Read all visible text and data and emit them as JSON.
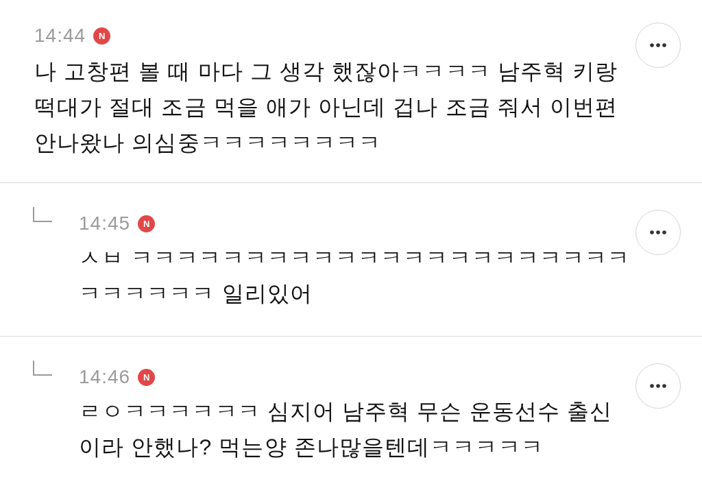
{
  "comments": [
    {
      "kind": "comment",
      "time": "14:44",
      "badge": "N",
      "lines": [
        "나 고창편 볼 때 마다 그 생각 했잖아ㅋㅋㅋㅋ 남주혁 키랑",
        "떡대가 절대 조금 먹을 애가 아닌데 겁나 조금 줘서 이번편",
        "안나왔나 의심중ㅋㅋㅋㅋㅋㅋㅋㅋ"
      ]
    },
    {
      "kind": "reply",
      "time": "14:45",
      "badge": "N",
      "lines": [
        "ㅅㅂ ㅋㅋㅋㅋㅋㅋㅋㅋㅋㅋㅋㅋㅋㅋㅋㅋㅋㅋㅋㅋㅋㅋ",
        "ㅋㅋㅋㅋㅋㅋ 일리있어"
      ]
    },
    {
      "kind": "reply",
      "time": "14:46",
      "badge": "N",
      "lines": [
        "ㄹㅇㅋㅋㅋㅋㅋㅋ 심지어 남주혁 무슨 운동선수 출신",
        "이라 안했나? 먹는양 존나많을텐데ㅋㅋㅋㅋㅋ"
      ]
    }
  ]
}
